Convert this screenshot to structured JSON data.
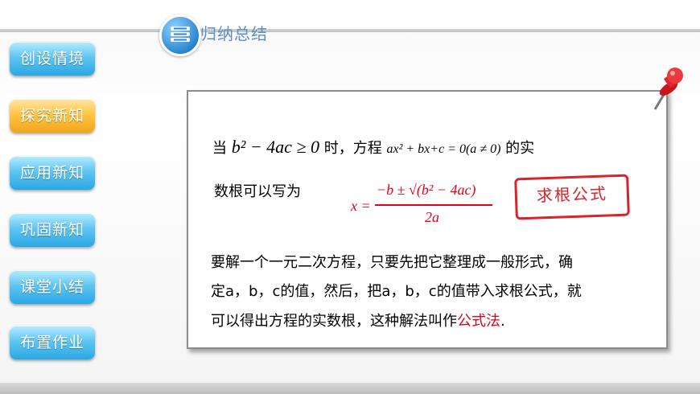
{
  "header": {
    "title": "归纳总结"
  },
  "nav": {
    "items": [
      {
        "label": "创设情境",
        "active": false
      },
      {
        "label": "探究新知",
        "active": true
      },
      {
        "label": "应用新知",
        "active": false
      },
      {
        "label": "巩固新知",
        "active": false
      },
      {
        "label": "课堂小结",
        "active": false
      },
      {
        "label": "布置作业",
        "active": false
      }
    ]
  },
  "card": {
    "line1_prefix": "当",
    "line1_condition": "b² − 4ac ≥ 0",
    "line1_mid": "时，方程",
    "line1_equation": "ax² + bx+c = 0(a ≠ 0)",
    "line1_suffix": "的实",
    "line2": "数根可以写为",
    "formula_lhs": "x =",
    "formula_numerator": "−b ± √(b² − 4ac)",
    "formula_denominator": "2a",
    "stamp": "求根公式",
    "para_line1": "要解一个一元二次方程，只要先把它整理成一般形式，确",
    "para_line2": "定a，b，c的值，然后，把a，b，c的值带入求根公式，就",
    "para_line3_text": "可以得出方程的实数根，这种解法叫作",
    "para_line3_highlight": "公式法",
    "para_line3_end": "."
  },
  "colors": {
    "accent_blue": "#2aa7e4",
    "active_orange": "#f2a51a",
    "highlight_red": "#e3001b"
  }
}
